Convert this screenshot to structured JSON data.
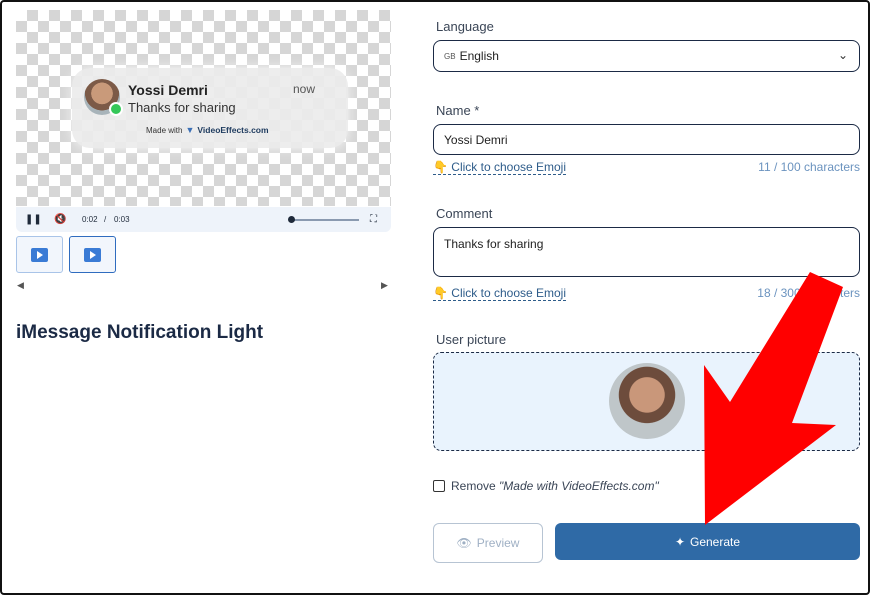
{
  "preview": {
    "notification": {
      "name": "Yossi Demri",
      "message": "Thanks for sharing",
      "time": "now",
      "made_with": "Made with",
      "brand": "VideoEffects.com"
    },
    "player": {
      "current_time": "0:02",
      "separator": "/",
      "duration": "0:03"
    },
    "effect_title": "iMessage Notification Light"
  },
  "form": {
    "language": {
      "label": "Language",
      "flag": "GB",
      "value": "English"
    },
    "name": {
      "label": "Name *",
      "value": "Yossi Demri",
      "emoji_link": "Click to choose Emoji",
      "counter": "11 / 100 characters"
    },
    "comment": {
      "label": "Comment",
      "value": "Thanks for sharing",
      "emoji_link": "Click to choose Emoji",
      "counter": "18 / 300 characters"
    },
    "user_picture": {
      "label": "User picture"
    },
    "remove_watermark": {
      "prefix": "Remove",
      "text": "\"Made with VideoEffects.com\""
    },
    "buttons": {
      "preview": "Preview",
      "generate": "Generate"
    }
  },
  "colors": {
    "accent": "#2f6aa6",
    "annotation": "#ff0000"
  }
}
